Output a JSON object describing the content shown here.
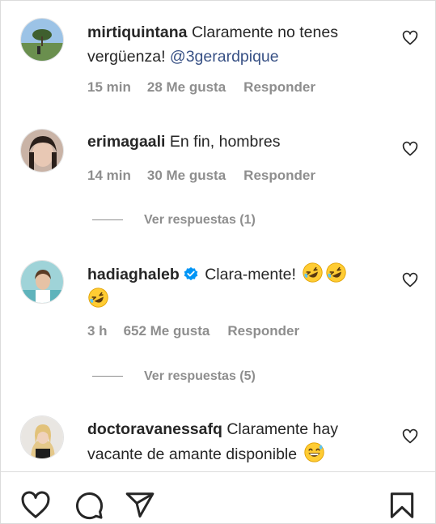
{
  "comments": [
    {
      "username": "mirtiquintana",
      "text": "Claramente no tenes vergüenza!",
      "mention": "@3gerardpique",
      "time": "15 min",
      "likes": "28 Me gusta",
      "reply": "Responder"
    },
    {
      "username": "erimagaali",
      "text": "En fin, hombres",
      "time": "14 min",
      "likes": "30 Me gusta",
      "reply": "Responder",
      "view_replies": "Ver respuestas (1)"
    },
    {
      "username": "hadiaghaleb",
      "text": "Clara-mente!",
      "verified": true,
      "time": "3 h",
      "likes": "652 Me gusta",
      "reply": "Responder",
      "view_replies": "Ver respuestas (5)"
    },
    {
      "username": "doctoravanessafq",
      "text": "Claramente hay vacante de amante disponible",
      "time": "",
      "likes": "",
      "reply": ""
    }
  ],
  "icons": {
    "like": "heart-icon",
    "comment": "comment-icon",
    "share": "send-icon",
    "save": "bookmark-icon",
    "verified": "verified-badge-icon",
    "emoji_laugh": "rolling-on-floor-laughing-emoji",
    "emoji_grin": "grinning-sweat-emoji"
  },
  "colors": {
    "text": "#262626",
    "secondary": "#8e8e8e",
    "mention": "#385185",
    "verified": "#0095f6",
    "emoji": "#ffcc33"
  }
}
